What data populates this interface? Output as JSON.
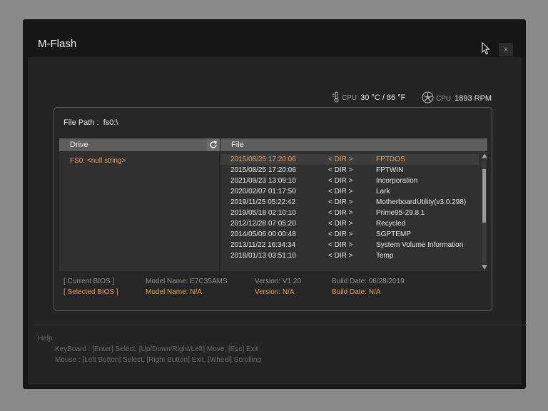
{
  "window": {
    "title": "M-Flash",
    "close_label": "x"
  },
  "hardware": {
    "cpu_temp_label": "CPU",
    "cpu_temp_value": "30 °C / 86 °F",
    "cpu_fan_label": "CPU",
    "cpu_fan_value": "1893 RPM"
  },
  "file_path": {
    "label": "File Path :",
    "value": "fs0:\\"
  },
  "drive_column": {
    "header": "Drive",
    "items": [
      "FS0: <null string>"
    ]
  },
  "file_column": {
    "header": "File",
    "rows": [
      {
        "date": "2015/08/25 17:20:06",
        "type": "< DIR >",
        "name": "FPTDOS",
        "selected": true
      },
      {
        "date": "2015/08/25 17:20:06",
        "type": "< DIR >",
        "name": "FPTWIN"
      },
      {
        "date": "2021/09/23 13:09:10",
        "type": "< DIR >",
        "name": "Incorporation"
      },
      {
        "date": "2020/02/07 01:17:50",
        "type": "< DIR >",
        "name": "Lark"
      },
      {
        "date": "2019/11/25 05:22:42",
        "type": "< DIR >",
        "name": "MotherboardUtility(v3.0.298)"
      },
      {
        "date": "2019/05/18 02:10:10",
        "type": "< DIR >",
        "name": "Prime95-29.8.1"
      },
      {
        "date": "2012/12/28 07:05:20",
        "type": "< DIR >",
        "name": "Recycled"
      },
      {
        "date": "2014/05/06 00:00:48",
        "type": "< DIR >",
        "name": "SGPTEMP"
      },
      {
        "date": "2013/11/22 16:34:34",
        "type": "< DIR >",
        "name": "System Volume Information"
      },
      {
        "date": "2018/01/13 03:51:10",
        "type": "< DIR >",
        "name": "Temp"
      }
    ]
  },
  "bios": {
    "current": {
      "label": "[ Current BIOS ]",
      "model": "Model Name: E7C35AMS",
      "version": "Version: V1.20",
      "build": "Build Date: 06/28/2019"
    },
    "selected": {
      "label": "[ Selected BIOS ]",
      "model": "Model Name: N/A",
      "version": "Version: N/A",
      "build": "Build Date: N/A"
    }
  },
  "help": {
    "title": "Help",
    "keyboard": "KeyBoard :  [Enter]  Select,   [Up/Down/Right/Left]  Move,   [Esc]  Exit",
    "mouse": "Mouse     :  [Left Button]  Select,   [Right Button]  Exit,   [Wheel]  Scrolling"
  },
  "colors": {
    "accent": "#e8a050",
    "background": "#161616",
    "panel": "#242424"
  }
}
